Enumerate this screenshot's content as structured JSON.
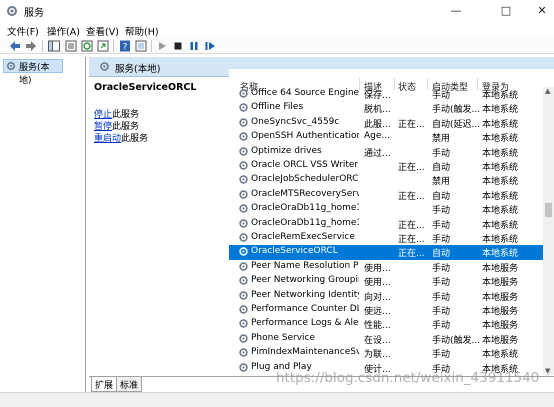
{
  "window": {
    "title": "服务"
  },
  "menu": [
    "文件(F)",
    "操作(A)",
    "查看(V)",
    "帮助(H)"
  ],
  "toolbar_icons": [
    "back-icon",
    "forward-icon",
    "show-tree-icon",
    "properties-icon",
    "refresh-icon",
    "export-icon",
    "help-icon",
    "view-icon",
    "start-service-icon",
    "stop-service-icon",
    "pause-service-icon",
    "restart-service-icon"
  ],
  "tree": {
    "item": "服务(本地)"
  },
  "header": {
    "title": "服务(本地)"
  },
  "details": {
    "service_name": "OracleServiceORCL",
    "stop_link": "停止",
    "stop_suffix": "此服务",
    "pause_link": "暂停",
    "pause_suffix": "此服务",
    "restart_link": "重启动",
    "restart_suffix": "此服务"
  },
  "columns": {
    "name": "名称",
    "desc": "描述",
    "status": "状态",
    "start": "启动类型",
    "logon": "登录为"
  },
  "rows": [
    {
      "name": "Office 64 Source Engine",
      "desc": "保存...",
      "status": "",
      "start": "手动",
      "logon": "本地系统"
    },
    {
      "name": "Offline Files",
      "desc": "脱机...",
      "status": "",
      "start": "手动(触发...",
      "logon": "本地系统"
    },
    {
      "name": "OneSyncSvc_4559c",
      "desc": "此服...",
      "status": "正在...",
      "start": "自动(延迟...",
      "logon": "本地系统"
    },
    {
      "name": "OpenSSH Authentication ...",
      "desc": "Age...",
      "status": "",
      "start": "禁用",
      "logon": "本地系统"
    },
    {
      "name": "Optimize drives",
      "desc": "通过...",
      "status": "",
      "start": "手动",
      "logon": "本地系统"
    },
    {
      "name": "Oracle ORCL VSS Writer S...",
      "desc": "",
      "status": "正在...",
      "start": "自动",
      "logon": "本地系统"
    },
    {
      "name": "OracleJobSchedulerORCL",
      "desc": "",
      "status": "",
      "start": "禁用",
      "logon": "本地系统"
    },
    {
      "name": "OracleMTSRecoveryService",
      "desc": "",
      "status": "正在...",
      "start": "自动",
      "logon": "本地系统"
    },
    {
      "name": "OracleOraDb11g_home1C...",
      "desc": "",
      "status": "",
      "start": "手动",
      "logon": "本地系统"
    },
    {
      "name": "OracleOraDb11g_home1T...",
      "desc": "",
      "status": "正在...",
      "start": "手动",
      "logon": "本地系统"
    },
    {
      "name": "OracleRemExecService",
      "desc": "",
      "status": "正在...",
      "start": "手动",
      "logon": "本地系统"
    },
    {
      "name": "OracleServiceORCL",
      "desc": "",
      "status": "正在...",
      "start": "自动",
      "logon": "本地系统",
      "selected": true
    },
    {
      "name": "Peer Name Resolution Pro...",
      "desc": "使用...",
      "status": "",
      "start": "手动",
      "logon": "本地服务"
    },
    {
      "name": "Peer Networking Grouping",
      "desc": "使用...",
      "status": "",
      "start": "手动",
      "logon": "本地服务"
    },
    {
      "name": "Peer Networking Identity ...",
      "desc": "向对...",
      "status": "",
      "start": "手动",
      "logon": "本地服务"
    },
    {
      "name": "Performance Counter DLL ...",
      "desc": "使远...",
      "status": "",
      "start": "手动",
      "logon": "本地服务"
    },
    {
      "name": "Performance Logs & Alerts",
      "desc": "性能...",
      "status": "",
      "start": "手动",
      "logon": "本地服务"
    },
    {
      "name": "Phone Service",
      "desc": "在设...",
      "status": "",
      "start": "手动(触发...",
      "logon": "本地服务"
    },
    {
      "name": "PimIndexMaintenanceSvc_...",
      "desc": "为联...",
      "status": "",
      "start": "手动",
      "logon": "本地系统"
    },
    {
      "name": "Plug and Play",
      "desc": "使计...",
      "status": "",
      "start": "手动",
      "logon": "本地系统"
    }
  ],
  "tabs": [
    "扩展",
    "标准"
  ],
  "watermark": "https://blog.csdn.net/weixin_43911540"
}
